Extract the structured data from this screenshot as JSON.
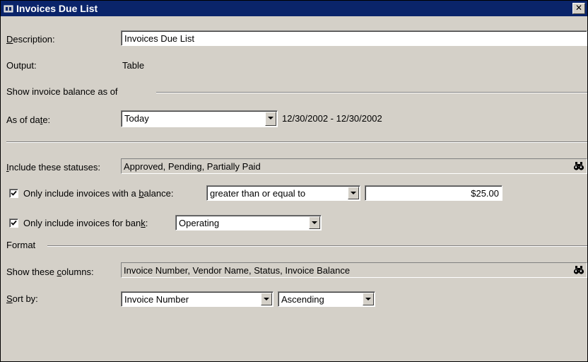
{
  "window": {
    "title": "Invoices Due List",
    "close_glyph": "✕",
    "icon": "report-icon"
  },
  "description": {
    "label": "Description:",
    "value": "Invoices Due List"
  },
  "output": {
    "label": "Output:",
    "value": "Table"
  },
  "show_balance_group": {
    "label": "Show invoice balance as of"
  },
  "as_of_date": {
    "label": "As of date:",
    "selected": "Today",
    "range_text": "12/30/2002 - 12/30/2002"
  },
  "statuses": {
    "label": "Include these statuses:",
    "value": "Approved, Pending, Partially Paid",
    "icon": "binoculars-icon"
  },
  "balance_filter": {
    "checked": true,
    "label": "Only include invoices with a balance:",
    "operator": "greater than or equal to",
    "amount": "$25.00"
  },
  "bank_filter": {
    "checked": true,
    "label": "Only include invoices for bank:",
    "selected": "Operating"
  },
  "format_group": {
    "label": "Format"
  },
  "columns": {
    "label": "Show these columns:",
    "value": "Invoice Number, Vendor Name, Status, Invoice Balance",
    "icon": "binoculars-icon"
  },
  "sort": {
    "label": "Sort by:",
    "field": "Invoice Number",
    "direction": "Ascending"
  },
  "colors": {
    "titlebar": "#0a246a",
    "face": "#d4d0c8"
  }
}
